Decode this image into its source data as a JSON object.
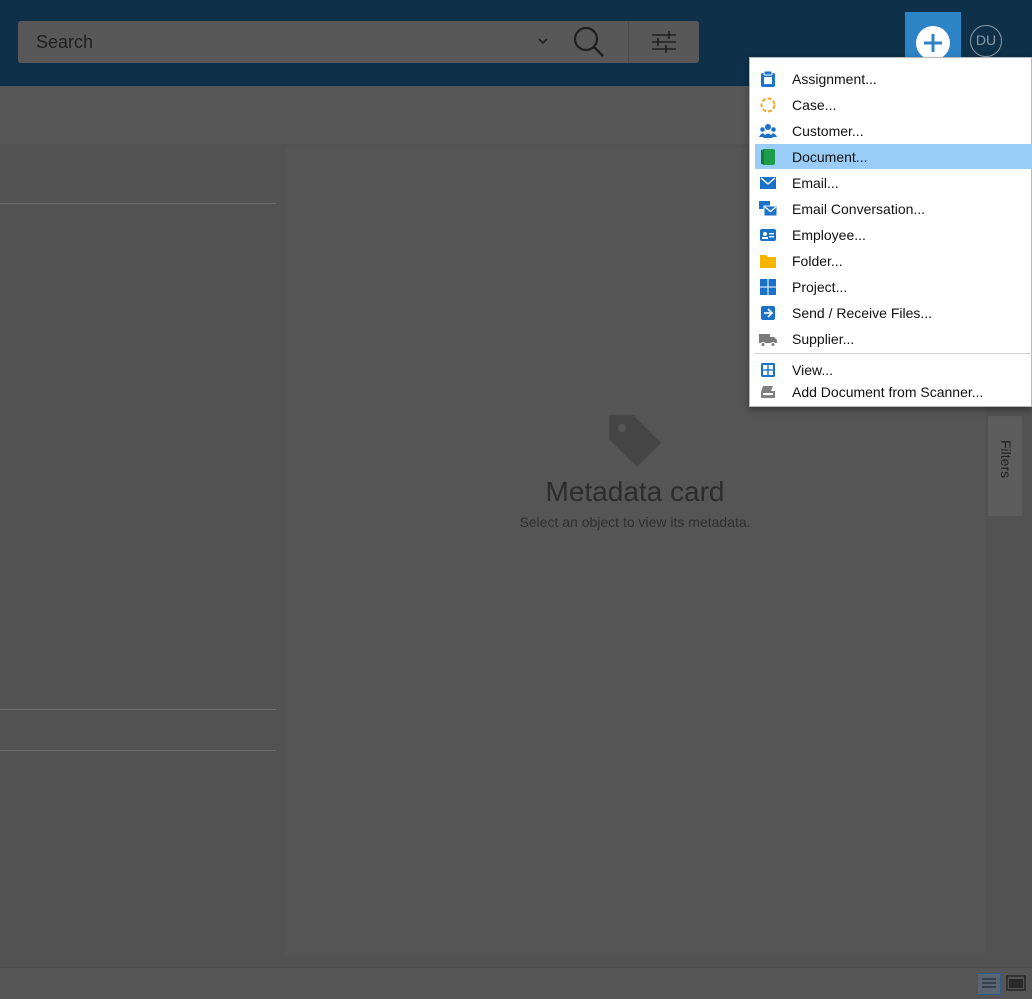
{
  "search": {
    "placeholder": "Search"
  },
  "user": {
    "initials": "DU"
  },
  "metadata_card": {
    "title": "Metadata card",
    "subtitle": "Select an object to view its metadata."
  },
  "side_tab": {
    "label": "Filters"
  },
  "new_menu": {
    "items": [
      {
        "label": "Assignment...",
        "icon": "assignment-icon"
      },
      {
        "label": "Case...",
        "icon": "case-icon"
      },
      {
        "label": "Customer...",
        "icon": "customer-icon"
      },
      {
        "label": "Document...",
        "icon": "document-icon",
        "highlighted": true
      },
      {
        "label": "Email...",
        "icon": "email-icon"
      },
      {
        "label": "Email Conversation...",
        "icon": "email-conversation-icon"
      },
      {
        "label": "Employee...",
        "icon": "employee-icon"
      },
      {
        "label": "Folder...",
        "icon": "folder-icon"
      },
      {
        "label": "Project...",
        "icon": "project-icon"
      },
      {
        "label": "Send / Receive Files...",
        "icon": "send-receive-icon"
      },
      {
        "label": "Supplier...",
        "icon": "supplier-icon"
      }
    ],
    "extra_items": [
      {
        "label": "View...",
        "icon": "view-icon"
      },
      {
        "label": "Add Document from Scanner...",
        "icon": "scanner-icon"
      }
    ]
  },
  "colors": {
    "topbar": "#0f3049",
    "accent": "#2c83c6",
    "menu_highlight": "#99ccf6",
    "overlay_bg": "#525252"
  }
}
